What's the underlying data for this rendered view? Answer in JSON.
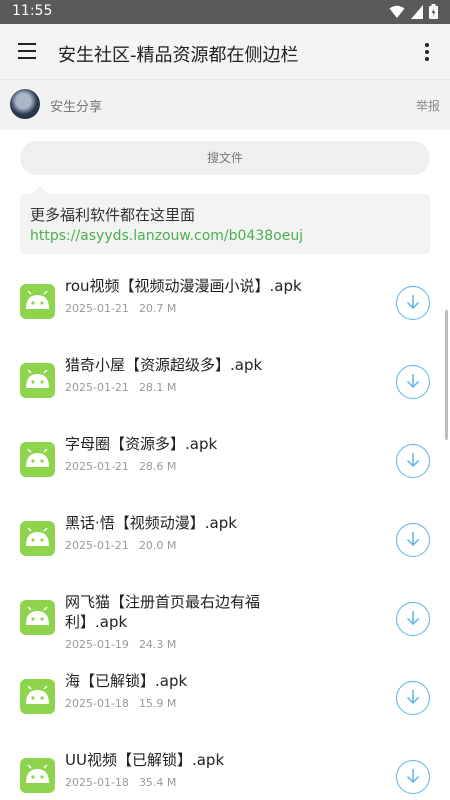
{
  "status_bar": {
    "time": "11:55"
  },
  "app_bar": {
    "title": "安生社区-精品资源都在侧边栏",
    "menu_icon": "menu-icon",
    "more_icon": "more-vert-icon"
  },
  "post": {
    "author": "安生分享",
    "report_label": "举报",
    "search_label": "搜文件",
    "notice_text": "更多福利软件都在这里面",
    "notice_link": "https://asyyds.lanzouw.com/b0438oeuj"
  },
  "files": [
    {
      "name": "rou视频【视频动漫漫画小说】.apk",
      "date": "2025-01-21",
      "size": "20.7 M"
    },
    {
      "name": "猎奇小屋【资源超级多】.apk",
      "date": "2025-01-21",
      "size": "28.1 M"
    },
    {
      "name": "字母圈【资源多】.apk",
      "date": "2025-01-21",
      "size": "28.6 M"
    },
    {
      "name": "黑话·悟【视频动漫】.apk",
      "date": "2025-01-21",
      "size": "20.0 M"
    },
    {
      "name": "网飞猫【注册首页最右边有福利】.apk",
      "date": "2025-01-19",
      "size": "24.3 M"
    },
    {
      "name": "海【已解锁】.apk",
      "date": "2025-01-18",
      "size": "15.9 M"
    },
    {
      "name": "UU视频【已解锁】.apk",
      "date": "2025-01-18",
      "size": "35.4 M"
    }
  ],
  "colors": {
    "accent_green": "#8fd44d",
    "link_green": "#4caf50",
    "download_blue": "#5ab4e8"
  }
}
